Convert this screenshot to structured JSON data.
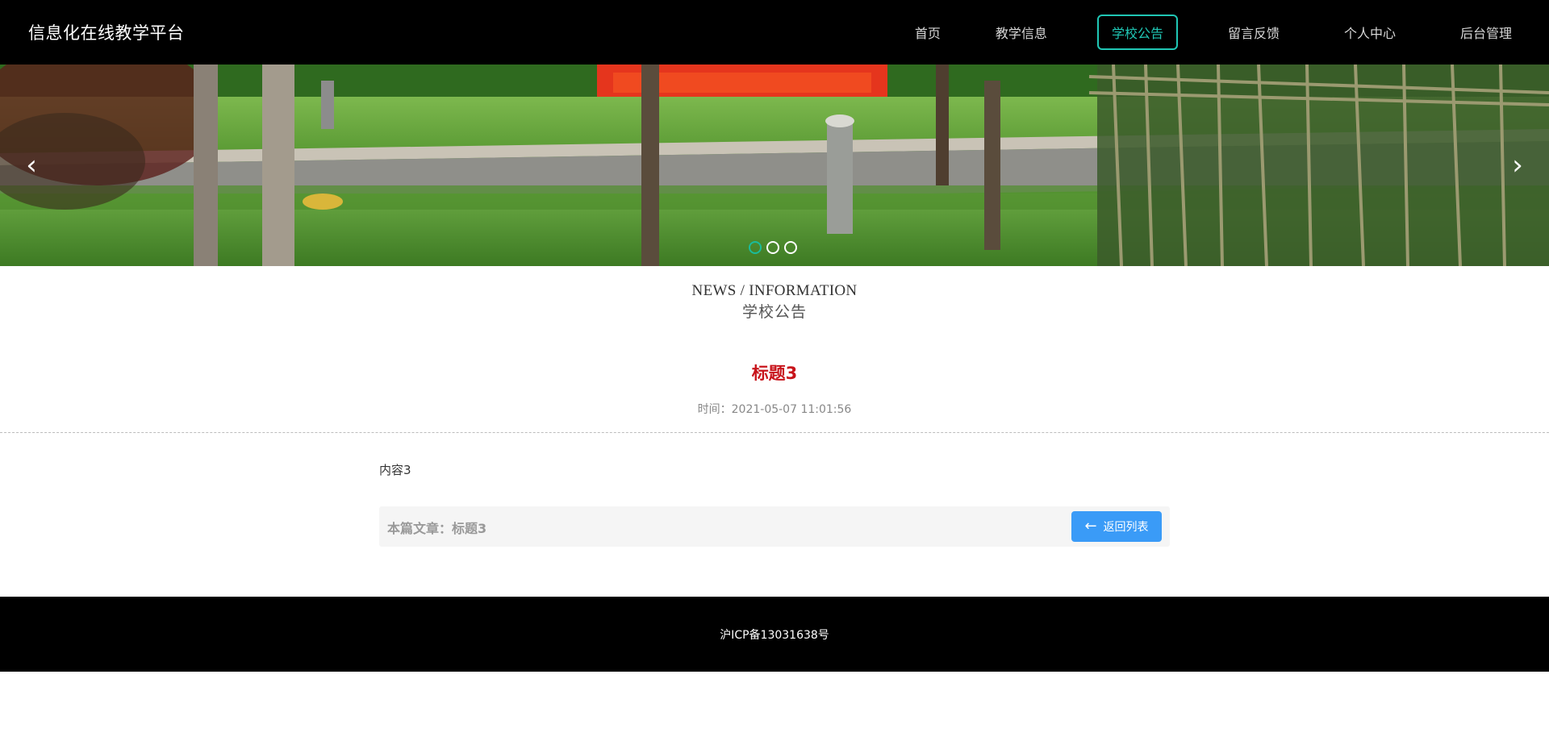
{
  "header": {
    "brand": "信息化在线教学平台",
    "nav": [
      {
        "label": "首页",
        "active": false
      },
      {
        "label": "教学信息",
        "active": false
      },
      {
        "label": "学校公告",
        "active": true
      },
      {
        "label": "留言反馈",
        "active": false
      },
      {
        "label": "个人中心",
        "active": false
      },
      {
        "label": "后台管理",
        "active": false
      }
    ]
  },
  "banner": {
    "prev_icon": "chevron-left-icon",
    "next_icon": "chevron-right-icon",
    "prev_glyph": "‹",
    "next_glyph": "›",
    "slide_count": 3,
    "active_slide": 1
  },
  "section": {
    "title_en": "NEWS / INFORMATION",
    "title_cn": "学校公告"
  },
  "article": {
    "title": "标题3",
    "time": "时间：2021-05-07 11:01:56",
    "content": "内容3",
    "this_article": "本篇文章：标题3",
    "back_label": "返回列表",
    "back_icon": "arrow-left-icon",
    "back_glyph": "←"
  },
  "footer": {
    "icp": "沪ICP备13031638号"
  },
  "colors": {
    "accent": "#20c7b5",
    "title_red": "#c8141b",
    "button_blue": "#3a9bf7"
  }
}
